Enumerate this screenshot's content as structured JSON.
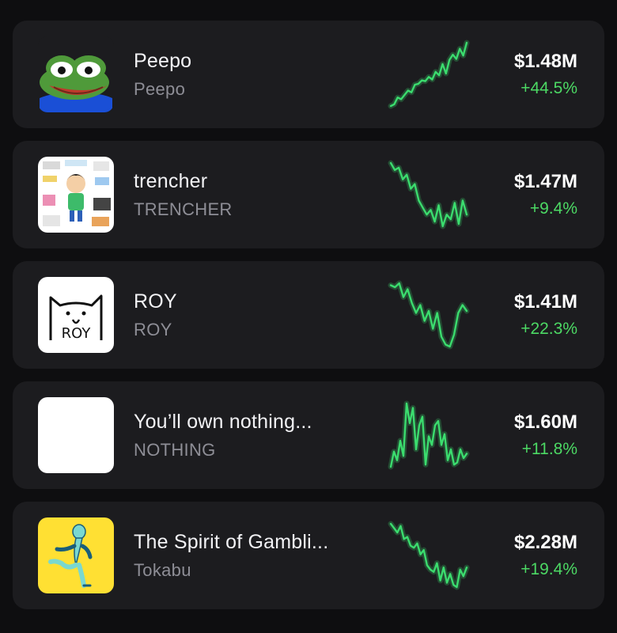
{
  "tokens": [
    {
      "name": "Peepo",
      "ticker": "Peepo",
      "price": "$1.48M",
      "change": "+44.5%",
      "avatar_icon": "pepe-frog-icon",
      "trend": [
        40,
        38,
        30,
        32,
        27,
        22,
        24,
        15,
        14,
        10,
        11,
        6,
        9,
        0,
        4,
        -9,
        2,
        -14,
        -20,
        -15,
        -27,
        -19,
        -34
      ]
    },
    {
      "name": "trencher",
      "ticker": "TRENCHER",
      "price": "$1.47M",
      "change": "+9.4%",
      "avatar_icon": "trencher-collage-icon",
      "trend": [
        -34,
        -28,
        -30,
        -20,
        -24,
        -12,
        -16,
        -2,
        4,
        10,
        6,
        16,
        2,
        20,
        10,
        14,
        0,
        18,
        -2,
        10
      ]
    },
    {
      "name": "ROY",
      "ticker": "ROY",
      "price": "$1.41M",
      "change": "+22.3%",
      "avatar_icon": "roy-cat-icon",
      "trend": [
        -32,
        -30,
        -34,
        -20,
        -28,
        -14,
        -4,
        -12,
        4,
        -6,
        12,
        -4,
        20,
        28,
        30,
        18,
        -4,
        -12,
        -6
      ]
    },
    {
      "name": "You’ll own nothing...",
      "ticker": "NOTHING",
      "price": "$1.60M",
      "change": "+11.8%",
      "avatar_icon": "white-square-icon",
      "trend": [
        30,
        16,
        24,
        6,
        20,
        -28,
        -10,
        -24,
        14,
        -8,
        -16,
        28,
        2,
        10,
        -8,
        -12,
        10,
        0,
        24,
        14,
        28,
        26,
        14,
        22,
        18
      ]
    },
    {
      "name": "The Spirit of Gambli...",
      "ticker": "Tokabu",
      "price": "$2.28M",
      "change": "+19.4%",
      "avatar_icon": "tokabu-character-icon",
      "trend": [
        -22,
        -18,
        -14,
        -20,
        -8,
        -10,
        -2,
        0,
        -4,
        6,
        2,
        16,
        20,
        22,
        14,
        30,
        18,
        32,
        24,
        34,
        36,
        20,
        26,
        18
      ]
    }
  ],
  "colors": {
    "background": "#0e0e10",
    "card": "#1c1c1f",
    "positive": "#4cd964",
    "sparkline": "#3bdc6e"
  }
}
